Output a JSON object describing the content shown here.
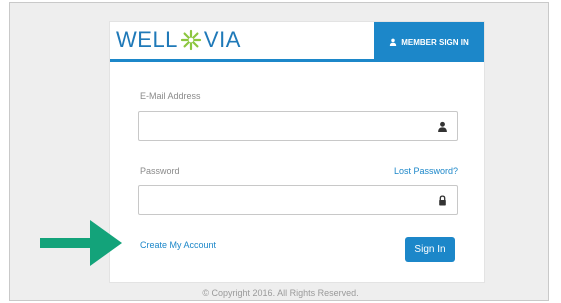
{
  "logo": {
    "left": "WELL",
    "right": "VIA"
  },
  "header": {
    "signin_tab": "MEMBER SIGN IN"
  },
  "form": {
    "email_label": "E-Mail Address",
    "email_value": "",
    "password_label": "Password",
    "password_value": "",
    "lost_password": "Lost Password?",
    "create_account": "Create My Account",
    "signin_button": "Sign In"
  },
  "footer": {
    "copyright": "© Copyright 2016. All Rights Reserved."
  },
  "colors": {
    "brand_blue": "#1c87c9",
    "logo_green": "#8cc63f",
    "arrow_green": "#13a37a"
  }
}
